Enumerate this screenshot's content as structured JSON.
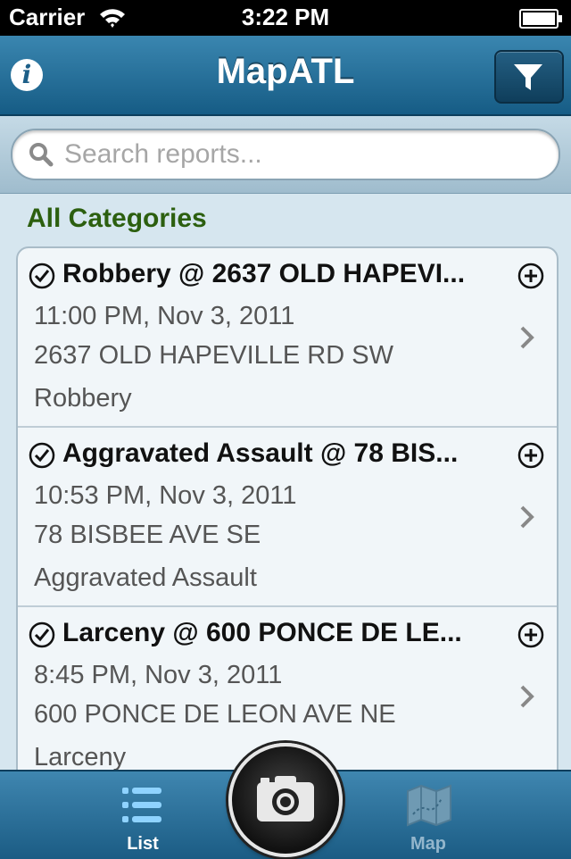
{
  "status": {
    "carrier": "Carrier",
    "time": "3:22 PM"
  },
  "nav": {
    "title": "MapATL",
    "info_icon": "info-icon",
    "filter_icon": "filter-icon"
  },
  "search": {
    "placeholder": "Search reports...",
    "value": ""
  },
  "section": {
    "title": "All Categories"
  },
  "reports": [
    {
      "title": "Robbery @ 2637 OLD HAPEVI...",
      "time": "11:00 PM, Nov 3, 2011",
      "address": "2637 OLD HAPEVILLE RD SW",
      "category": "Robbery"
    },
    {
      "title": "Aggravated Assault @ 78 BIS...",
      "time": "10:53 PM, Nov 3, 2011",
      "address": "78 BISBEE AVE SE",
      "category": "Aggravated Assault"
    },
    {
      "title": "Larceny @ 600 PONCE DE LE...",
      "time": "8:45 PM, Nov 3, 2011",
      "address": "600 PONCE DE LEON AVE NE",
      "category": "Larceny"
    }
  ],
  "tabs": {
    "list": "List",
    "map": "Map",
    "active": "List"
  },
  "colors": {
    "nav": "#1d6a96",
    "section_header": "#2c5f0f",
    "active_tab": "#ffffff",
    "inactive_tab": "#93b6cc"
  }
}
